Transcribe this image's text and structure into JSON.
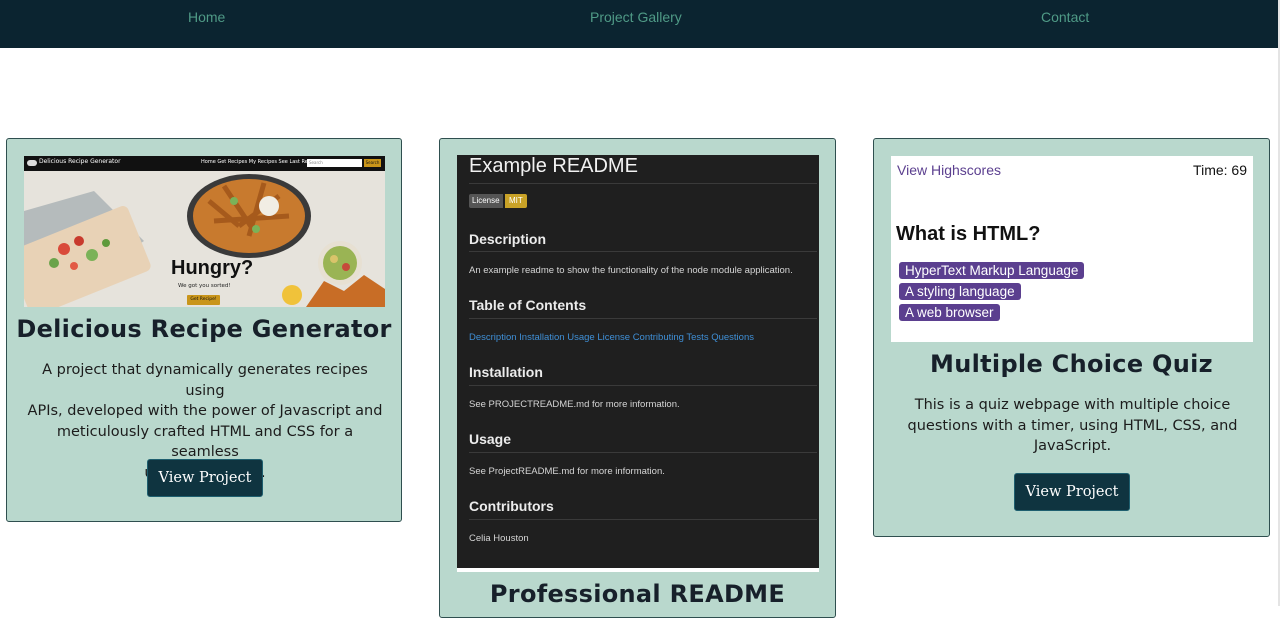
{
  "nav": {
    "home": "Home",
    "gallery": "Project Gallery",
    "contact": "Contact"
  },
  "cards": [
    {
      "title": "Delicious Recipe Generator",
      "desc_lines": [
        "A project that dynamically generates recipes using",
        "APIs, developed with the power of Javascript and",
        "meticulously crafted HTML and CSS for a seamless",
        "user experience."
      ],
      "button": "View Project",
      "thumb": {
        "brand": "Delicious Recipe Generator",
        "links": "Home  Get Recipes  My Recipes  See Last Results",
        "search_placeholder": "Search",
        "search_btn": "Search",
        "headline": "Hungry?",
        "subtext": "We got you sorted!",
        "cta": "Get Recipe!"
      }
    },
    {
      "title": "Professional README",
      "thumb": {
        "h1": "Example README",
        "badge_label": "License",
        "badge_value": "MIT",
        "sections": [
          {
            "heading": "Description",
            "text": "An example readme to show the functionality of the node module application."
          },
          {
            "heading": "Table of Contents",
            "links": "Description Installation Usage License Contributing Tests Questions"
          },
          {
            "heading": "Installation",
            "text": "See PROJECTREADME.md for more information."
          },
          {
            "heading": "Usage",
            "text": "See ProjectREADME.md for more information."
          },
          {
            "heading": "Contributors",
            "text": "Celia Houston"
          }
        ]
      }
    },
    {
      "title": "Multiple Choice Quiz",
      "desc_lines": [
        "This is a quiz webpage with multiple choice",
        "questions with a timer, using HTML, CSS, and",
        "JavaScript."
      ],
      "button": "View Project",
      "thumb": {
        "highscores": "View Highscores",
        "time": "Time: 69",
        "question": "What is HTML?",
        "options": [
          "HyperText Markup Language",
          "A styling language",
          "A web browser"
        ]
      }
    }
  ],
  "colors": {
    "nav_bg": "#0b2430",
    "nav_link": "#4f9a86",
    "card_bg": "#b9d8cd",
    "button_bg": "#0f3440",
    "quiz_option": "#5b3f8f",
    "recipe_accent": "#c9951a"
  }
}
